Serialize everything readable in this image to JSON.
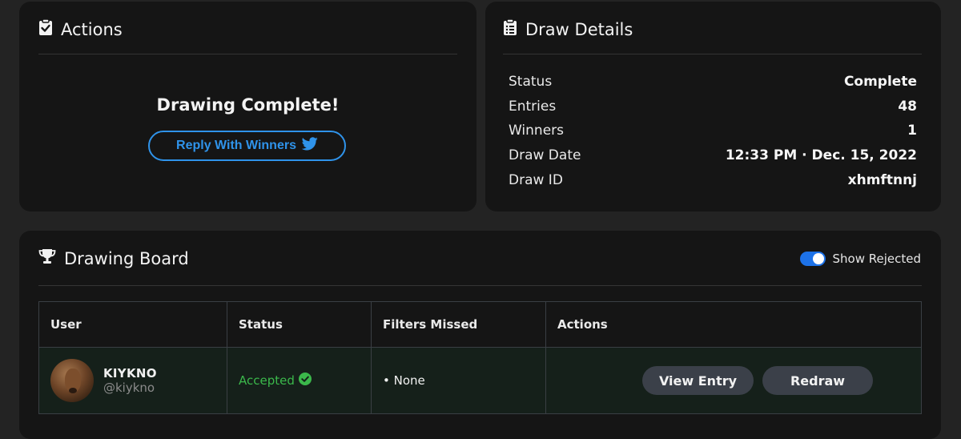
{
  "actions": {
    "title": "Actions",
    "complete_text": "Drawing Complete!",
    "reply_button": "Reply With Winners"
  },
  "details": {
    "title": "Draw Details",
    "rows": [
      {
        "label": "Status",
        "value": "Complete"
      },
      {
        "label": "Entries",
        "value": "48"
      },
      {
        "label": "Winners",
        "value": "1"
      },
      {
        "label": "Draw Date",
        "value": "12:33 PM · Dec. 15, 2022"
      },
      {
        "label": "Draw ID",
        "value": "xhmftnnj"
      }
    ]
  },
  "board": {
    "title": "Drawing Board",
    "toggle_label": "Show Rejected",
    "toggle_on": true,
    "columns": [
      "User",
      "Status",
      "Filters Missed",
      "Actions"
    ],
    "rows": [
      {
        "name": "KIYKNO",
        "handle": "@kiykno",
        "status": "Accepted",
        "filters_missed": "• None",
        "view_button": "View Entry",
        "redraw_button": "Redraw"
      }
    ]
  },
  "colors": {
    "accent_blue": "#2f93ea",
    "accepted_green": "#3bb84b",
    "toggle_blue": "#1d72e8"
  },
  "icons": {
    "actions": "clipboard-check-icon",
    "details": "clipboard-list-icon",
    "board": "trophy-icon",
    "reply": "twitter-bird-icon",
    "accepted": "check-circle-icon"
  }
}
